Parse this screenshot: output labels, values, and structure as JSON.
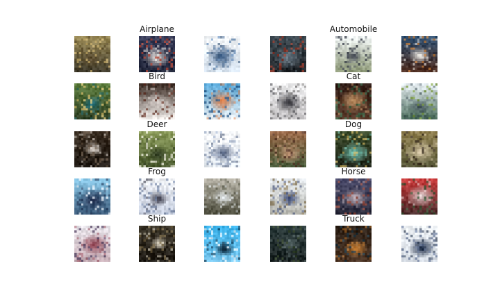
{
  "figure": {
    "classes": [
      {
        "title": "Airplane",
        "samples": [
          {
            "bg": [
              "#9a8a56",
              "#3f3a2a"
            ],
            "fg": "#5a4a2e",
            "accent": "#c9b070"
          },
          {
            "bg": [
              "#3a3e5a",
              "#1f2438"
            ],
            "fg": "#e8e2dc",
            "accent": "#b84a3a"
          },
          {
            "bg": [
              "#f5f8fb",
              "#d6e2ee"
            ],
            "fg": "#2a4d78",
            "accent": "#6b8fb8"
          }
        ]
      },
      {
        "title": "Automobile",
        "samples": [
          {
            "bg": [
              "#3e4a52",
              "#1e2226"
            ],
            "fg": "#6a7a86",
            "accent": "#9c3a2a"
          },
          {
            "bg": [
              "#eef3f2",
              "#8f9a7a"
            ],
            "fg": "#4a4f5a",
            "accent": "#2f3440"
          },
          {
            "bg": [
              "#2f4e6e",
              "#4a2a1e"
            ],
            "fg": "#f2efe8",
            "accent": "#c47c3a"
          }
        ]
      },
      {
        "title": "Bird",
        "samples": [
          {
            "bg": [
              "#5a7a3a",
              "#2e3f24"
            ],
            "fg": "#2a7a8a",
            "accent": "#d8c070"
          },
          {
            "bg": [
              "#3a2a22",
              "#f0ece8"
            ],
            "fg": "#d8d0cc",
            "accent": "#6a3a2e"
          },
          {
            "bg": [
              "#5aa8d8",
              "#e8eef2"
            ],
            "fg": "#d8743a",
            "accent": "#2a5a8a"
          }
        ]
      },
      {
        "title": "Cat",
        "samples": [
          {
            "bg": [
              "#eeeeef",
              "#c8c6c8"
            ],
            "fg": "#2a2a30",
            "accent": "#8a8888"
          },
          {
            "bg": [
              "#2e1a14",
              "#5a3a2a"
            ],
            "fg": "#c09060",
            "accent": "#3a6a4a"
          },
          {
            "bg": [
              "#e6eef2",
              "#4a6a5a"
            ],
            "fg": "#3a4a52",
            "accent": "#7a9a3a"
          }
        ]
      },
      {
        "title": "Deer",
        "samples": [
          {
            "bg": [
              "#3a2e22",
              "#1e1812"
            ],
            "fg": "#e8e0d8",
            "accent": "#6a5a4a"
          },
          {
            "bg": [
              "#8a9a5a",
              "#4a5a2e"
            ],
            "fg": "#2e3a22",
            "accent": "#e8e8d8"
          },
          {
            "bg": [
              "#f7f9fc",
              "#e6ecf2"
            ],
            "fg": "#4a5a7a",
            "accent": "#9aa8c0"
          }
        ]
      },
      {
        "title": "Dog",
        "samples": [
          {
            "bg": [
              "#9a6a4a",
              "#4a5a3a"
            ],
            "fg": "#c89a7a",
            "accent": "#5a3a2e"
          },
          {
            "bg": [
              "#3a4a2a",
              "#1e2418"
            ],
            "fg": "#7ad0c0",
            "accent": "#c8b060"
          },
          {
            "bg": [
              "#8a7a4a",
              "#5a5a3a"
            ],
            "fg": "#d8c8a8",
            "accent": "#3a2e22"
          }
        ]
      },
      {
        "title": "Frog",
        "samples": [
          {
            "bg": [
              "#8ac8e8",
              "#3a5a7a"
            ],
            "fg": "#1e2a4a",
            "accent": "#e8f0f8"
          },
          {
            "bg": [
              "#f2f4f8",
              "#c8d0e0"
            ],
            "fg": "#2a2a3a",
            "accent": "#7a8aa8"
          },
          {
            "bg": [
              "#b8b4a8",
              "#4a4a3a"
            ],
            "fg": "#e8eef2",
            "accent": "#6a6a5a"
          }
        ]
      },
      {
        "title": "Horse",
        "samples": [
          {
            "bg": [
              "#e8ecf0",
              "#b8b8b0"
            ],
            "fg": "#2a3a6a",
            "accent": "#8a7a5a"
          },
          {
            "bg": [
              "#4a4a6a",
              "#2a2a3a"
            ],
            "fg": "#c8b8c0",
            "accent": "#9a4a3a"
          },
          {
            "bg": [
              "#c83a3a",
              "#4a2a2a"
            ],
            "fg": "#e8dcdc",
            "accent": "#3a5a3a"
          }
        ]
      },
      {
        "title": "Ship",
        "samples": [
          {
            "bg": [
              "#e8e4ea",
              "#c8b0b8"
            ],
            "fg": "#8a3a4a",
            "accent": "#5a4a6a"
          },
          {
            "bg": [
              "#3a3428",
              "#1e1a14"
            ],
            "fg": "#e8e0cc",
            "accent": "#7a6a4a"
          },
          {
            "bg": [
              "#38b0e8",
              "#7ac8f0"
            ],
            "fg": "#0a1a2a",
            "accent": "#e8f4fc"
          }
        ]
      },
      {
        "title": "Truck",
        "samples": [
          {
            "bg": [
              "#2a3a3a",
              "#1a2222"
            ],
            "fg": "#5a6a6a",
            "accent": "#3a4a2e"
          },
          {
            "bg": [
              "#2e2218",
              "#4a3222"
            ],
            "fg": "#d88a3a",
            "accent": "#1e3a4a"
          },
          {
            "bg": [
              "#eef2f6",
              "#d8dee6"
            ],
            "fg": "#0e1e3a",
            "accent": "#6a7a9a"
          }
        ]
      }
    ]
  }
}
